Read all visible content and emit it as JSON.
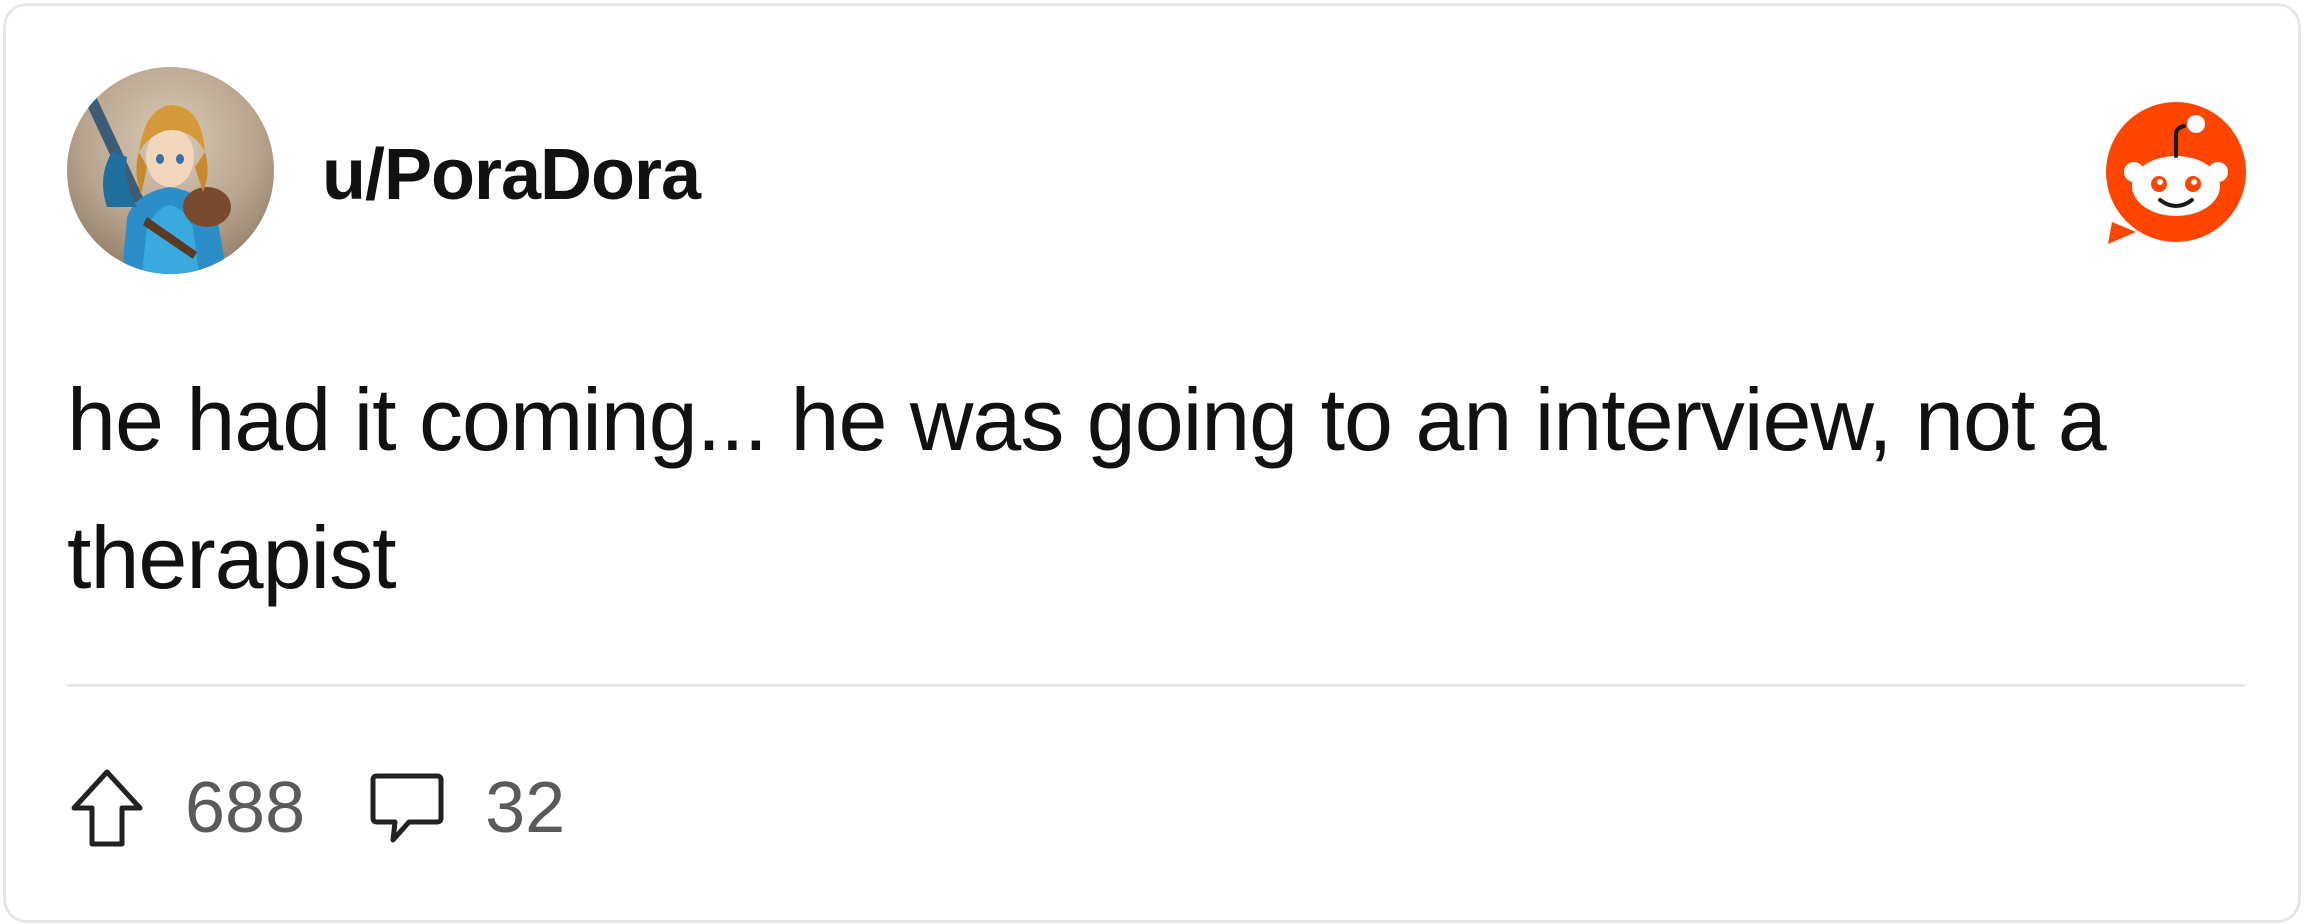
{
  "post": {
    "username": "u/PoraDora",
    "body": "he had it coming... he was going to an interview, not a therapist"
  },
  "stats": {
    "upvotes": "688",
    "comments": "32"
  },
  "icons": {
    "avatar": "user-avatar",
    "brand": "reddit-logo-icon",
    "upvote": "upvote-arrow-icon",
    "comment": "comment-bubble-icon"
  },
  "colors": {
    "brand": "#ff4500",
    "text": "#111111",
    "muted": "#5a5a5a",
    "border": "#e6e6e6"
  }
}
